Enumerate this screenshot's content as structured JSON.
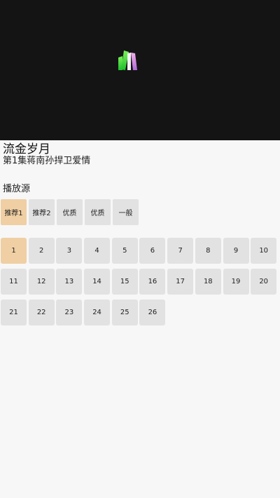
{
  "video": {
    "title": "流金岁月",
    "episode_title": "第1集蒋南孙捍卫爱情"
  },
  "sources": {
    "label": "播放源",
    "items": [
      "推荐1",
      "推荐2",
      "优质",
      "优质",
      "一般"
    ],
    "selected_index": 0
  },
  "episodes": {
    "items": [
      "1",
      "2",
      "3",
      "4",
      "5",
      "6",
      "7",
      "8",
      "9",
      "10",
      "11",
      "12",
      "13",
      "14",
      "15",
      "16",
      "17",
      "18",
      "19",
      "20",
      "21",
      "22",
      "23",
      "24",
      "25",
      "26"
    ],
    "selected_index": 0
  },
  "colors": {
    "player_bg": "#141414",
    "selected": "#efcfa3",
    "chip": "#e2e2e2",
    "page_bg": "#f7f7f7"
  },
  "icons": {
    "player_logo": "books-logo-icon"
  }
}
